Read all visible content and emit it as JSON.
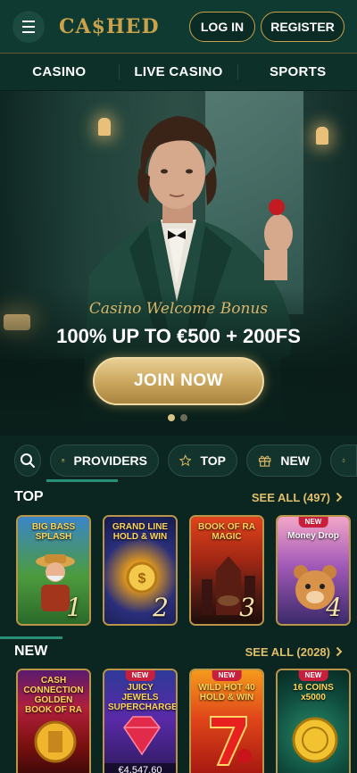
{
  "header": {
    "logo": "CA$HED",
    "login_label": "LOG IN",
    "register_label": "REGISTER"
  },
  "nav": {
    "items": [
      {
        "label": "CASINO"
      },
      {
        "label": "LIVE CASINO"
      },
      {
        "label": "SPORTS"
      }
    ]
  },
  "hero": {
    "subtitle": "Casino Welcome Bonus",
    "title": "100% UP TO €500 + 200FS",
    "cta_label": "JOIN NOW",
    "slides_total": 2,
    "slide_active": 1
  },
  "filters": {
    "providers_label": "PROVIDERS",
    "top_label": "TOP",
    "new_label": "NEW"
  },
  "sections": {
    "top": {
      "title": "TOP",
      "see_all": "SEE ALL (497)",
      "games": [
        {
          "title": "BIG BASS SPLASH",
          "rank": "1",
          "badge": ""
        },
        {
          "title": "GRAND LINE HOLD & WIN",
          "rank": "2",
          "badge": ""
        },
        {
          "title": "BOOK OF RA MAGIC",
          "rank": "3",
          "badge": ""
        },
        {
          "title": "Money Drop",
          "rank": "4",
          "badge": "NEW"
        }
      ]
    },
    "new": {
      "title": "NEW",
      "see_all": "SEE ALL (2028)",
      "games": [
        {
          "title": "CASH CONNECTION GOLDEN BOOK OF RA",
          "badge": "",
          "price": ""
        },
        {
          "title": "JUICY JEWELS SUPERCHARGED",
          "badge": "NEW",
          "price": "€4,547.60"
        },
        {
          "title": "WILD HOT 40 HOLD & WIN",
          "badge": "NEW",
          "price": ""
        },
        {
          "title": "16 COINS x5000",
          "badge": "NEW",
          "price": ""
        }
      ]
    }
  },
  "colors": {
    "accent_gold": "#c9a24b",
    "background": "#0b2621",
    "header": "#0f3a31",
    "new_badge": "#c81f3d",
    "underline": "#2b8f77"
  }
}
